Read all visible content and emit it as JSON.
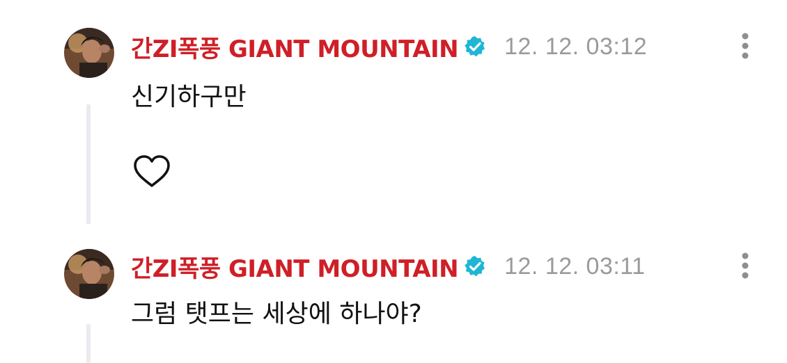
{
  "comments": [
    {
      "author": "간ZI폭풍 GIANT MOUNTAIN",
      "verified": true,
      "timestamp": "12. 12. 03:12",
      "text": "신기하구만",
      "like_icon": "heart-outline-icon",
      "menu_icon": "more-vertical-icon"
    },
    {
      "author": "간ZI폭풍 GIANT MOUNTAIN",
      "verified": true,
      "timestamp": "12. 12. 03:11",
      "text": "그럼 탯프는 세상에 하나야?",
      "menu_icon": "more-vertical-icon"
    }
  ],
  "colors": {
    "author": "#cf1f27",
    "verified_badge": "#1fb6d5",
    "timestamp": "#9a9a9a",
    "thread_line": "#ebebef",
    "menu_dots": "#8e8e8e"
  }
}
